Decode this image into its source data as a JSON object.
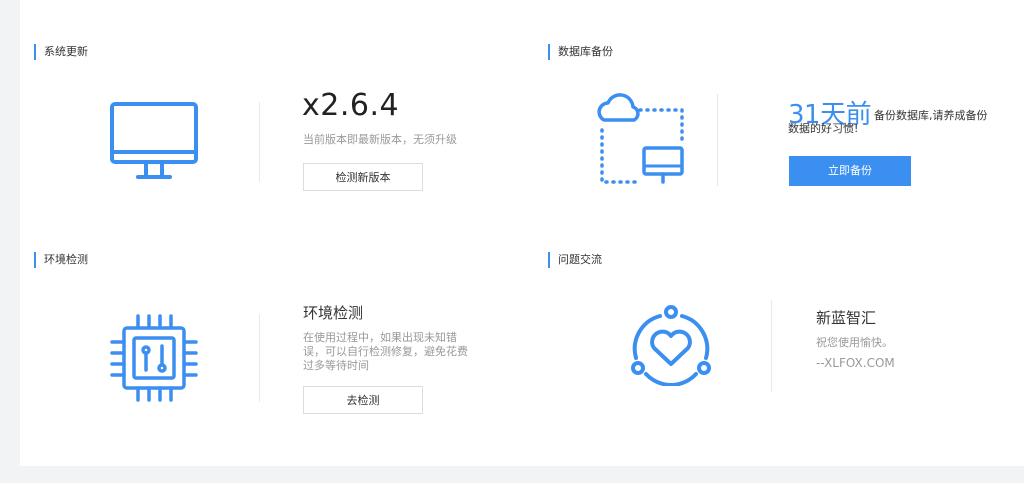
{
  "colors": {
    "accent": "#3b8ff0",
    "background": "#f2f3f5",
    "panel": "#ffffff"
  },
  "update": {
    "title": "系统更新",
    "version": "x2.6.4",
    "status": "当前版本即最新版本，无须升级",
    "button": "检测新版本",
    "icon": "monitor-icon"
  },
  "backup": {
    "title": "数据库备份",
    "days": "31天前",
    "note_line1": "备份数据库,请养成备份",
    "note_line2": "数据的好习惯!",
    "button": "立即备份",
    "icon": "cloud-to-monitor-icon"
  },
  "env": {
    "title": "环境检测",
    "heading": "环境检测",
    "desc_line1": "在使用过程中，如果出现未知错",
    "desc_line2": "误，可以自行检测修复，避免花费",
    "desc_line3": "过多等待时间",
    "button": "去检测",
    "icon": "chip-icon"
  },
  "community": {
    "title": "问题交流",
    "name": "新蓝智汇",
    "greeting": "祝您使用愉快。",
    "site": "--XLFOX.COM",
    "icon": "heart-community-icon"
  }
}
